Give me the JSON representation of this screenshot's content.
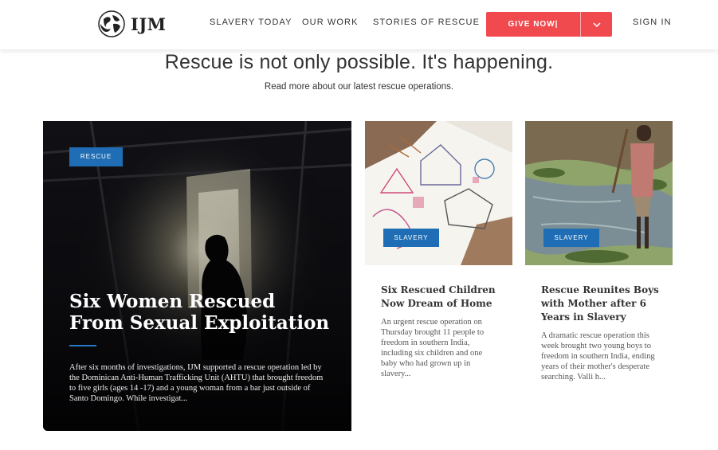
{
  "header": {
    "logo_text": "IJM",
    "nav": [
      "SLAVERY TODAY",
      "OUR WORK",
      "STORIES OF RESCUE"
    ],
    "give_label": "GIVE NOW|",
    "sign_in": "SIGN IN",
    "accent": "#f04a4f"
  },
  "intro": {
    "headline": "Rescue is not only possible. It's happening.",
    "subhead": "Read more about our latest rescue operations."
  },
  "featured": {
    "badge": "RESCUE",
    "title": "Six Women Rescued From Sexual Exploitation",
    "excerpt": "After six months of investigations, IJM supported a rescue operation led by the Dominican Anti-Human Trafficking Unit (AHTU) that brought freedom to five girls (ages 14 -17) and a young woman from a bar just outside of Santo Domingo. While investigat..."
  },
  "cards": [
    {
      "badge": "SLAVERY",
      "title": "Six Rescued Children Now Dream of Home",
      "excerpt": "An urgent rescue operation on Thursday brought 11 people to freedom in southern India, including six children and one baby who had grown up in slavery..."
    },
    {
      "badge": "SLAVERY",
      "title": "Rescue Reunites Boys with Mother after 6 Years in Slavery",
      "excerpt": "A dramatic rescue operation this week brought two young boys to freedom in southern India, ending years of their mother's desperate searching. Valli h..."
    }
  ],
  "colors": {
    "badge": "#1f6db4",
    "give": "#f04a4f"
  }
}
